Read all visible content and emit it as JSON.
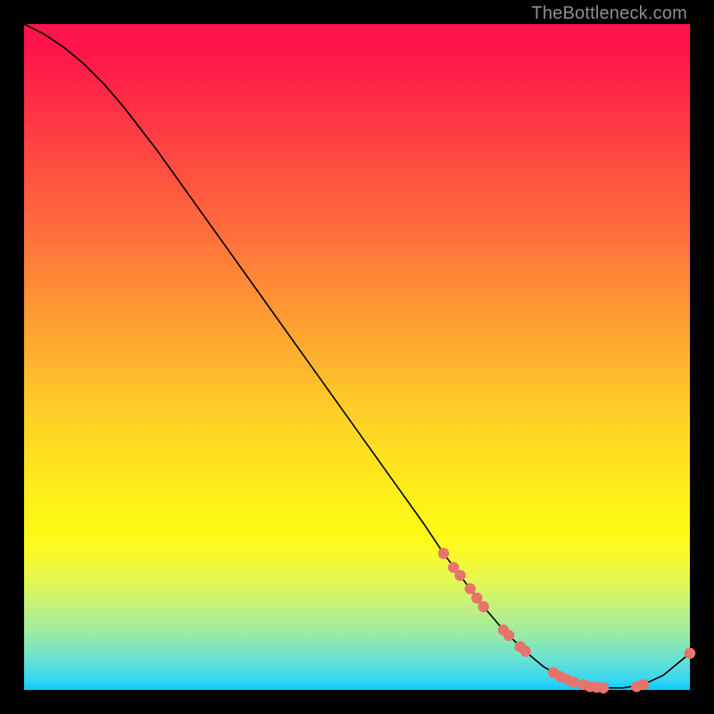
{
  "watermark": "TheBottleneck.com",
  "colors": {
    "point_fill": "#e8736d",
    "point_stroke": "#c95751",
    "line": "#000000"
  },
  "chart_data": {
    "type": "line",
    "title": "",
    "xlabel": "",
    "ylabel": "",
    "xlim": [
      0,
      100
    ],
    "ylim": [
      0,
      100
    ],
    "series": [
      {
        "name": "curve",
        "x": [
          0,
          3,
          6,
          9,
          12,
          15,
          20,
          25,
          30,
          35,
          40,
          45,
          50,
          55,
          60,
          63,
          66,
          69,
          72,
          75,
          78,
          81,
          84,
          87,
          90,
          93,
          96,
          100
        ],
        "y": [
          100,
          98.5,
          96.5,
          94,
          91,
          87.5,
          81,
          74,
          67,
          60,
          53,
          46,
          39,
          32,
          25,
          20.5,
          16.5,
          12.5,
          9,
          6,
          3.5,
          1.8,
          0.8,
          0.3,
          0.3,
          0.8,
          2.2,
          5.5
        ]
      }
    ],
    "points": [
      {
        "x": 63.0,
        "y": 20.5
      },
      {
        "x": 64.5,
        "y": 18.4
      },
      {
        "x": 65.5,
        "y": 17.2
      },
      {
        "x": 67.0,
        "y": 15.2
      },
      {
        "x": 68.0,
        "y": 13.8
      },
      {
        "x": 69.0,
        "y": 12.5
      },
      {
        "x": 72.0,
        "y": 9.0
      },
      {
        "x": 72.8,
        "y": 8.2
      },
      {
        "x": 74.5,
        "y": 6.5
      },
      {
        "x": 75.3,
        "y": 5.8
      },
      {
        "x": 79.5,
        "y": 2.6
      },
      {
        "x": 80.5,
        "y": 2.0
      },
      {
        "x": 81.5,
        "y": 1.6
      },
      {
        "x": 82.5,
        "y": 1.2
      },
      {
        "x": 84.0,
        "y": 0.8
      },
      {
        "x": 85.0,
        "y": 0.5
      },
      {
        "x": 86.0,
        "y": 0.4
      },
      {
        "x": 87.0,
        "y": 0.3
      },
      {
        "x": 92.0,
        "y": 0.5
      },
      {
        "x": 93.0,
        "y": 0.8
      },
      {
        "x": 100.0,
        "y": 5.5
      }
    ]
  }
}
